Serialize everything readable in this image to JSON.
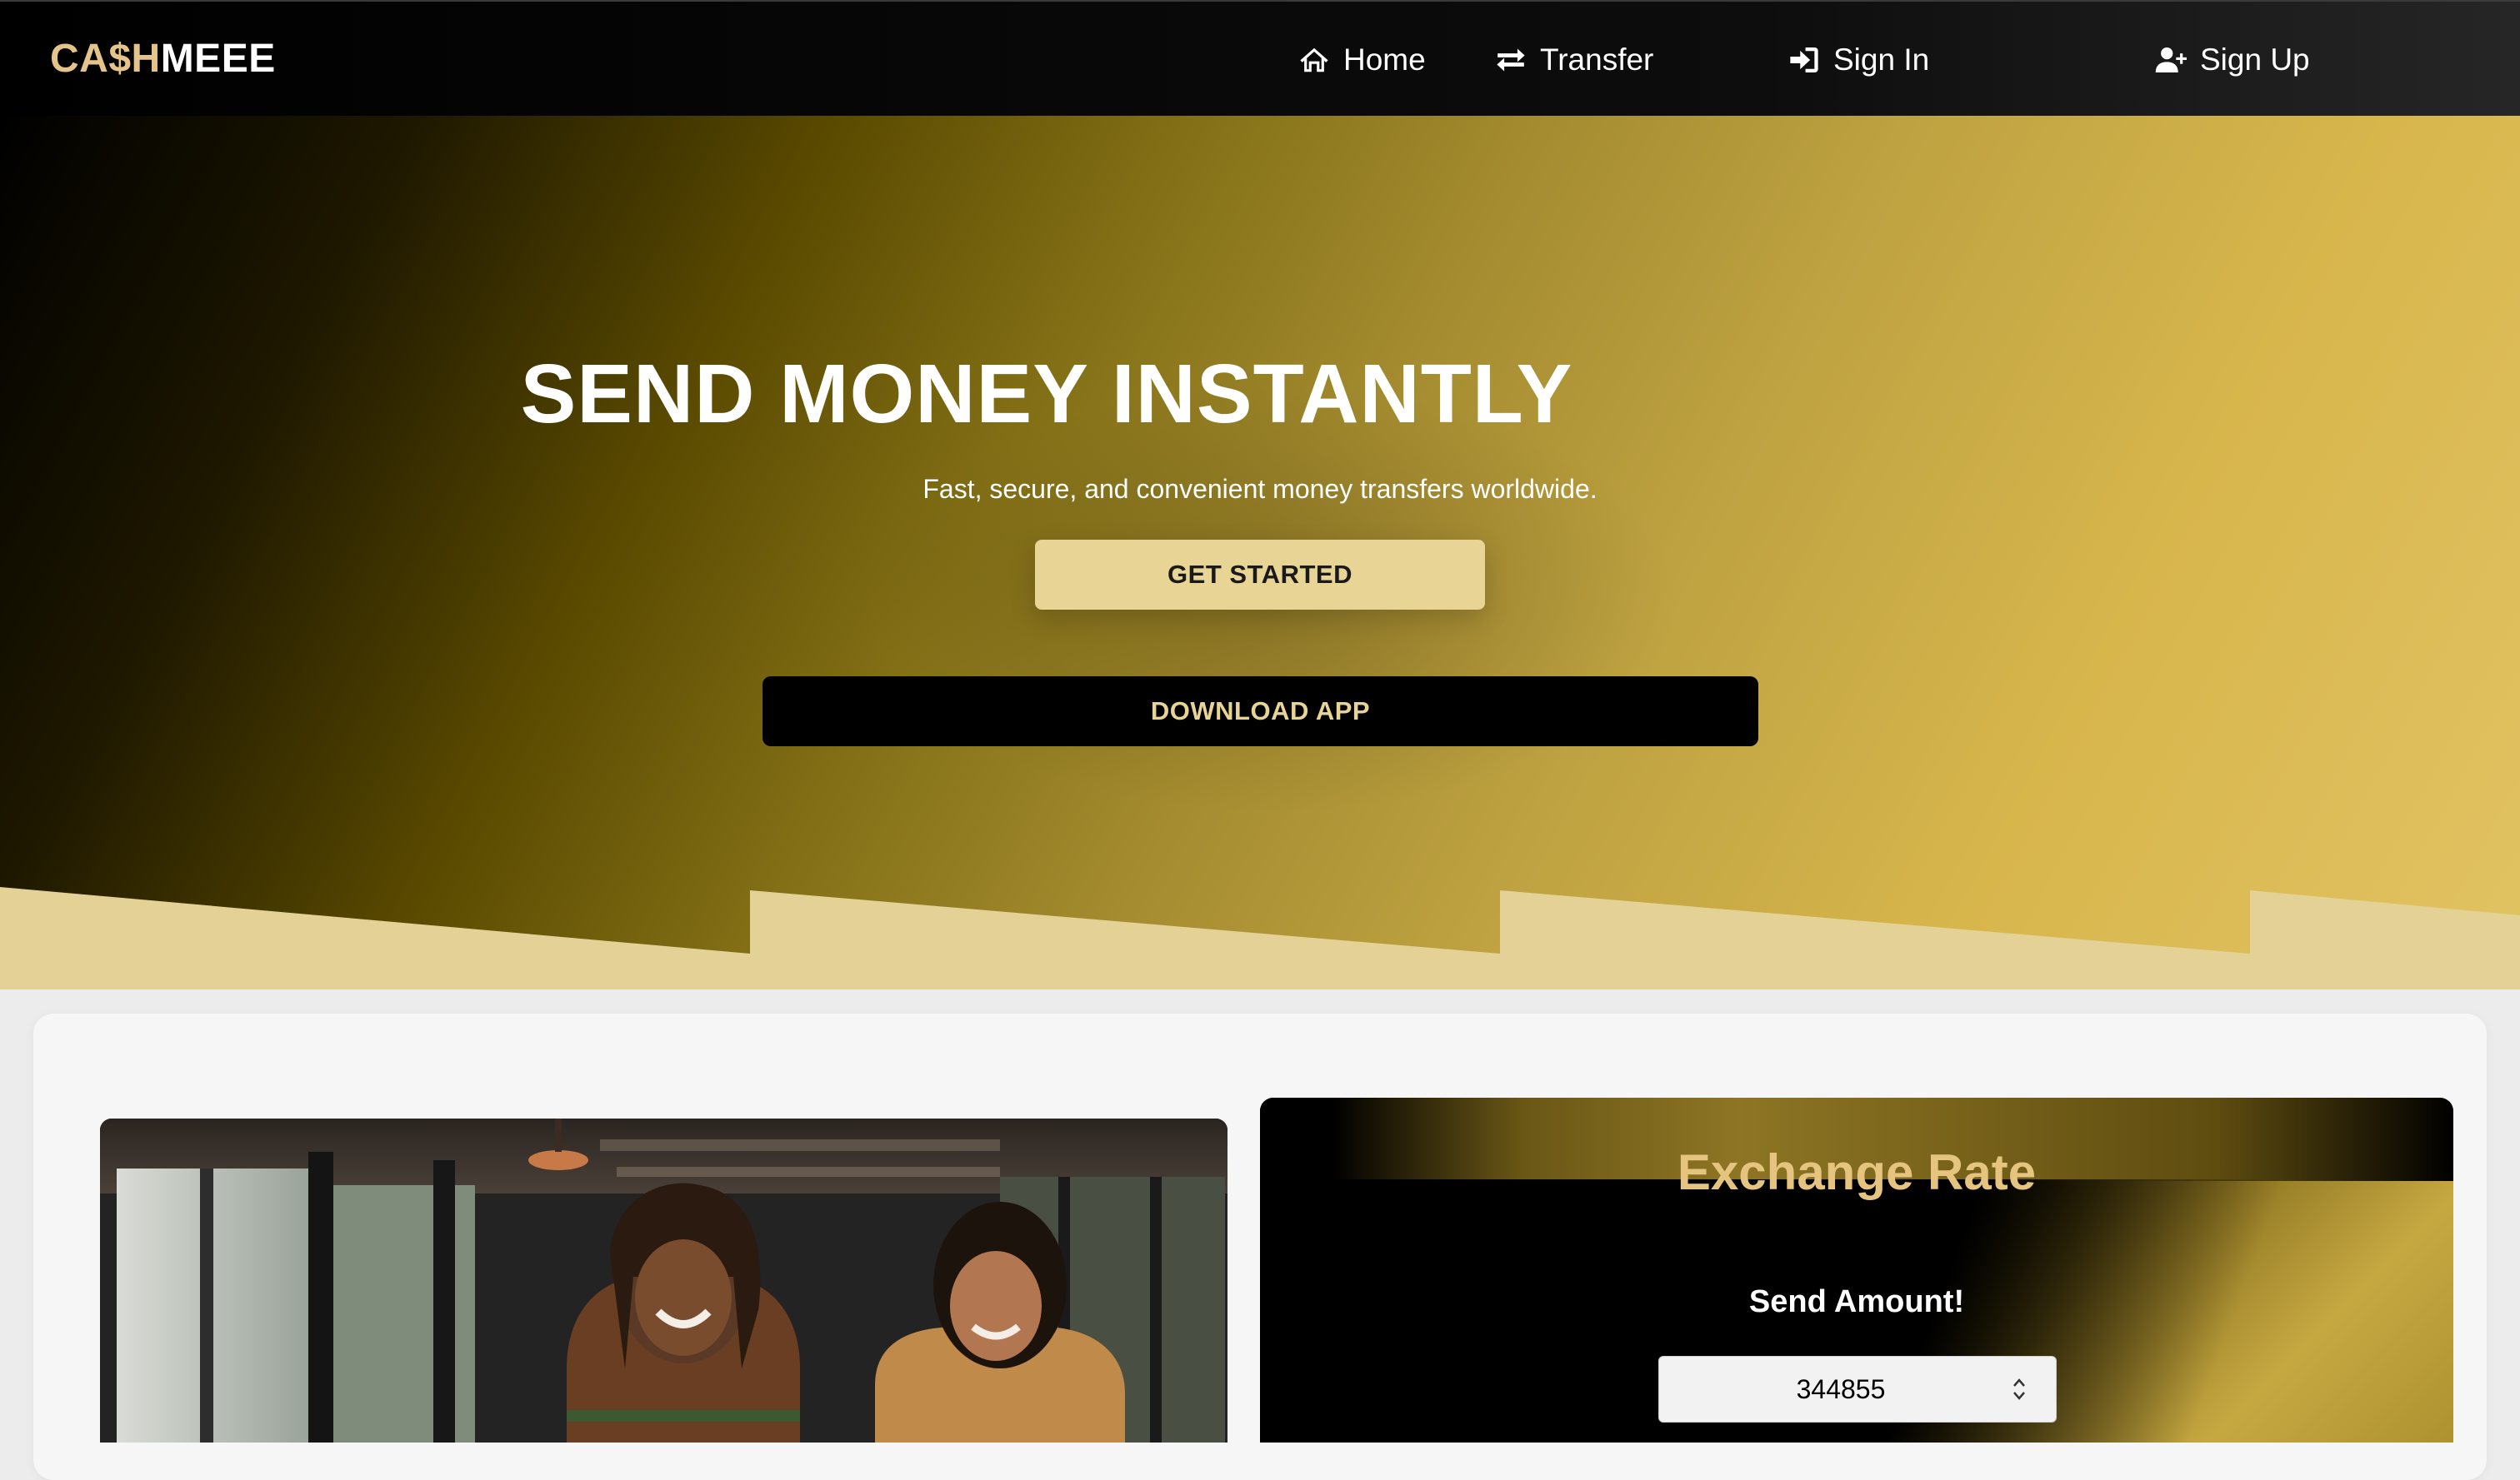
{
  "nav": {
    "logo_part1": "CA$H",
    "logo_part2": "MEEE",
    "items": [
      {
        "label": "Home",
        "icon": "home-icon"
      },
      {
        "label": "Transfer",
        "icon": "transfer-arrows-icon"
      },
      {
        "label": "Sign In",
        "icon": "sign-in-icon"
      },
      {
        "label": "Sign Up",
        "icon": "user-plus-icon"
      }
    ]
  },
  "hero": {
    "title": "SEND MONEY INSTANTLY",
    "subtitle": "Fast, secure, and convenient money transfers worldwide.",
    "primary_button": "GET STARTED",
    "secondary_button": "DOWNLOAD APP"
  },
  "exchange": {
    "title": "Exchange Rate",
    "send_label": "Send Amount!",
    "amount_value": "344855"
  },
  "colors": {
    "accent_gold": "#e4c48a",
    "button_gold": "#e8d494",
    "nav_bg": "#000000",
    "hero_gradient_end": "#e2c363"
  }
}
